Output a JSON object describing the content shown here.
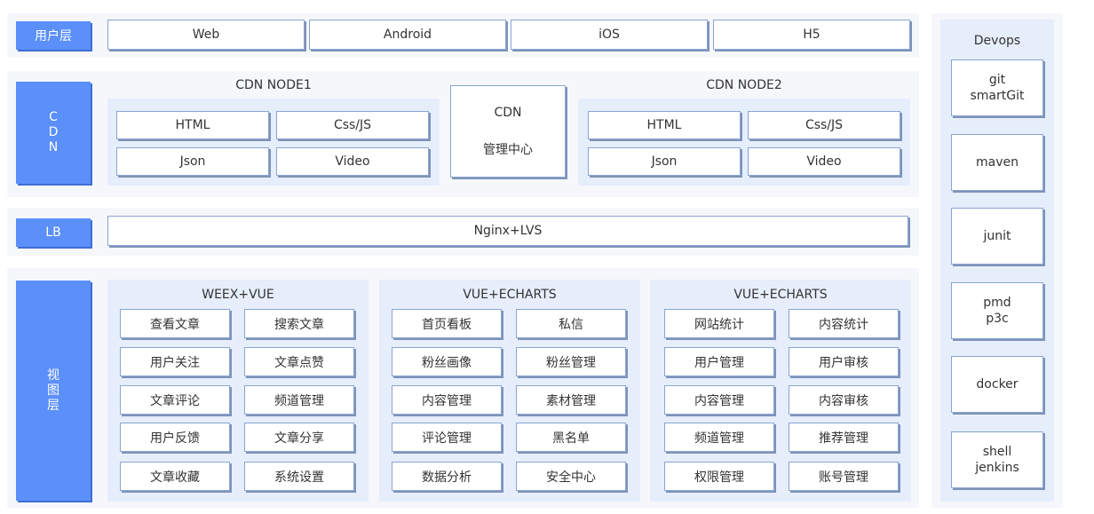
{
  "user_layer": {
    "label": "用户层",
    "items": [
      "Web",
      "Android",
      "iOS",
      "H5"
    ]
  },
  "cdn": {
    "label_chars": [
      "C",
      "D",
      "N"
    ],
    "node1": {
      "title": "CDN NODE1",
      "items": [
        "HTML",
        "Css/JS",
        "Json",
        "Video"
      ]
    },
    "center": {
      "line1": "CDN",
      "line2": "管理中心"
    },
    "node2": {
      "title": "CDN NODE2",
      "items": [
        "HTML",
        "Css/JS",
        "Json",
        "Video"
      ]
    }
  },
  "lb": {
    "label": "LB",
    "value": "Nginx+LVS"
  },
  "view": {
    "label_chars": [
      "视",
      "图",
      "层"
    ],
    "groups": [
      {
        "title": "WEEX+VUE",
        "items": [
          "查看文章",
          "搜索文章",
          "用户关注",
          "文章点赞",
          "文章评论",
          "频道管理",
          "用户反馈",
          "文章分享",
          "文章收藏",
          "系统设置"
        ]
      },
      {
        "title": "VUE+ECHARTS",
        "items": [
          "首页看板",
          "私信",
          "粉丝画像",
          "粉丝管理",
          "内容管理",
          "素材管理",
          "评论管理",
          "黑名单",
          "数据分析",
          "安全中心"
        ]
      },
      {
        "title": "VUE+ECHARTS",
        "items": [
          "网站统计",
          "内容统计",
          "用户管理",
          "用户审核",
          "内容管理",
          "内容审核",
          "频道管理",
          "推荐管理",
          "权限管理",
          "账号管理"
        ]
      }
    ]
  },
  "devops": {
    "title": "Devops",
    "items": [
      {
        "lines": [
          "git",
          "smartGit"
        ]
      },
      {
        "lines": [
          "maven"
        ]
      },
      {
        "lines": [
          "junit"
        ]
      },
      {
        "lines": [
          "pmd",
          "p3c"
        ]
      },
      {
        "lines": [
          "docker"
        ]
      },
      {
        "lines": [
          "shell",
          "jenkins"
        ]
      }
    ]
  }
}
